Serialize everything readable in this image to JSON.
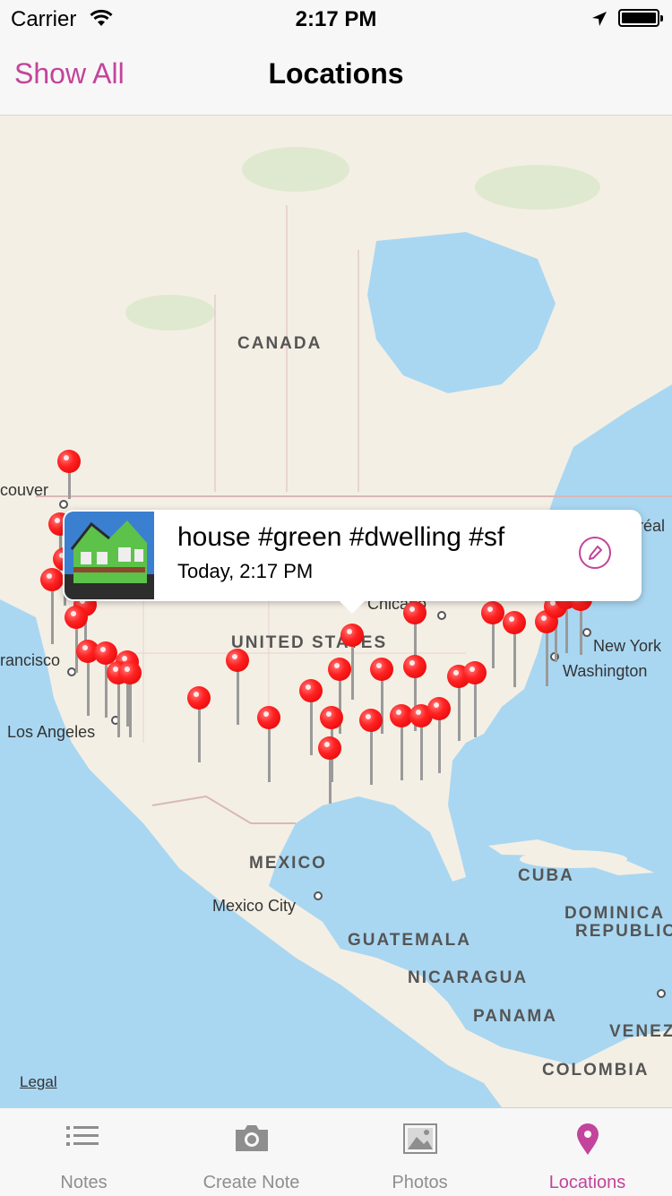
{
  "status_bar": {
    "carrier": "Carrier",
    "time": "2:17 PM"
  },
  "nav": {
    "left_button": "Show All",
    "title": "Locations"
  },
  "map": {
    "labels": {
      "canada": "CANADA",
      "united_states": "UNITED STATES",
      "mexico": "MEXICO",
      "cuba": "CUBA",
      "dominican_republic_1": "DOMINICA",
      "dominican_republic_2": "REPUBLIC",
      "guatemala": "GUATEMALA",
      "nicaragua": "NICARAGUA",
      "panama": "PANAMA",
      "colombia": "COLOMBIA",
      "venezuela": "VENEZ"
    },
    "cities": {
      "vancouver": "couver",
      "san_francisco": "rancisco",
      "los_angeles": "Los Angeles",
      "chicago": "Chicago",
      "new_york": "New York",
      "washington": "Washington",
      "mexico_city": "Mexico City",
      "montreal": "réal"
    },
    "legal": "Legal"
  },
  "callout": {
    "title": "house #green #dwelling #sf",
    "subtitle": "Today, 2:17 PM"
  },
  "tabs": [
    {
      "label": "Notes",
      "icon": "list-icon",
      "active": false
    },
    {
      "label": "Create Note",
      "icon": "camera-icon",
      "active": false
    },
    {
      "label": "Photos",
      "icon": "photo-icon",
      "active": false
    },
    {
      "label": "Locations",
      "icon": "map-pin-icon",
      "active": true
    }
  ],
  "colors": {
    "accent": "#c2449b",
    "pin": "#ee2222",
    "water": "#a9d7f2",
    "land": "#f4efe4"
  }
}
